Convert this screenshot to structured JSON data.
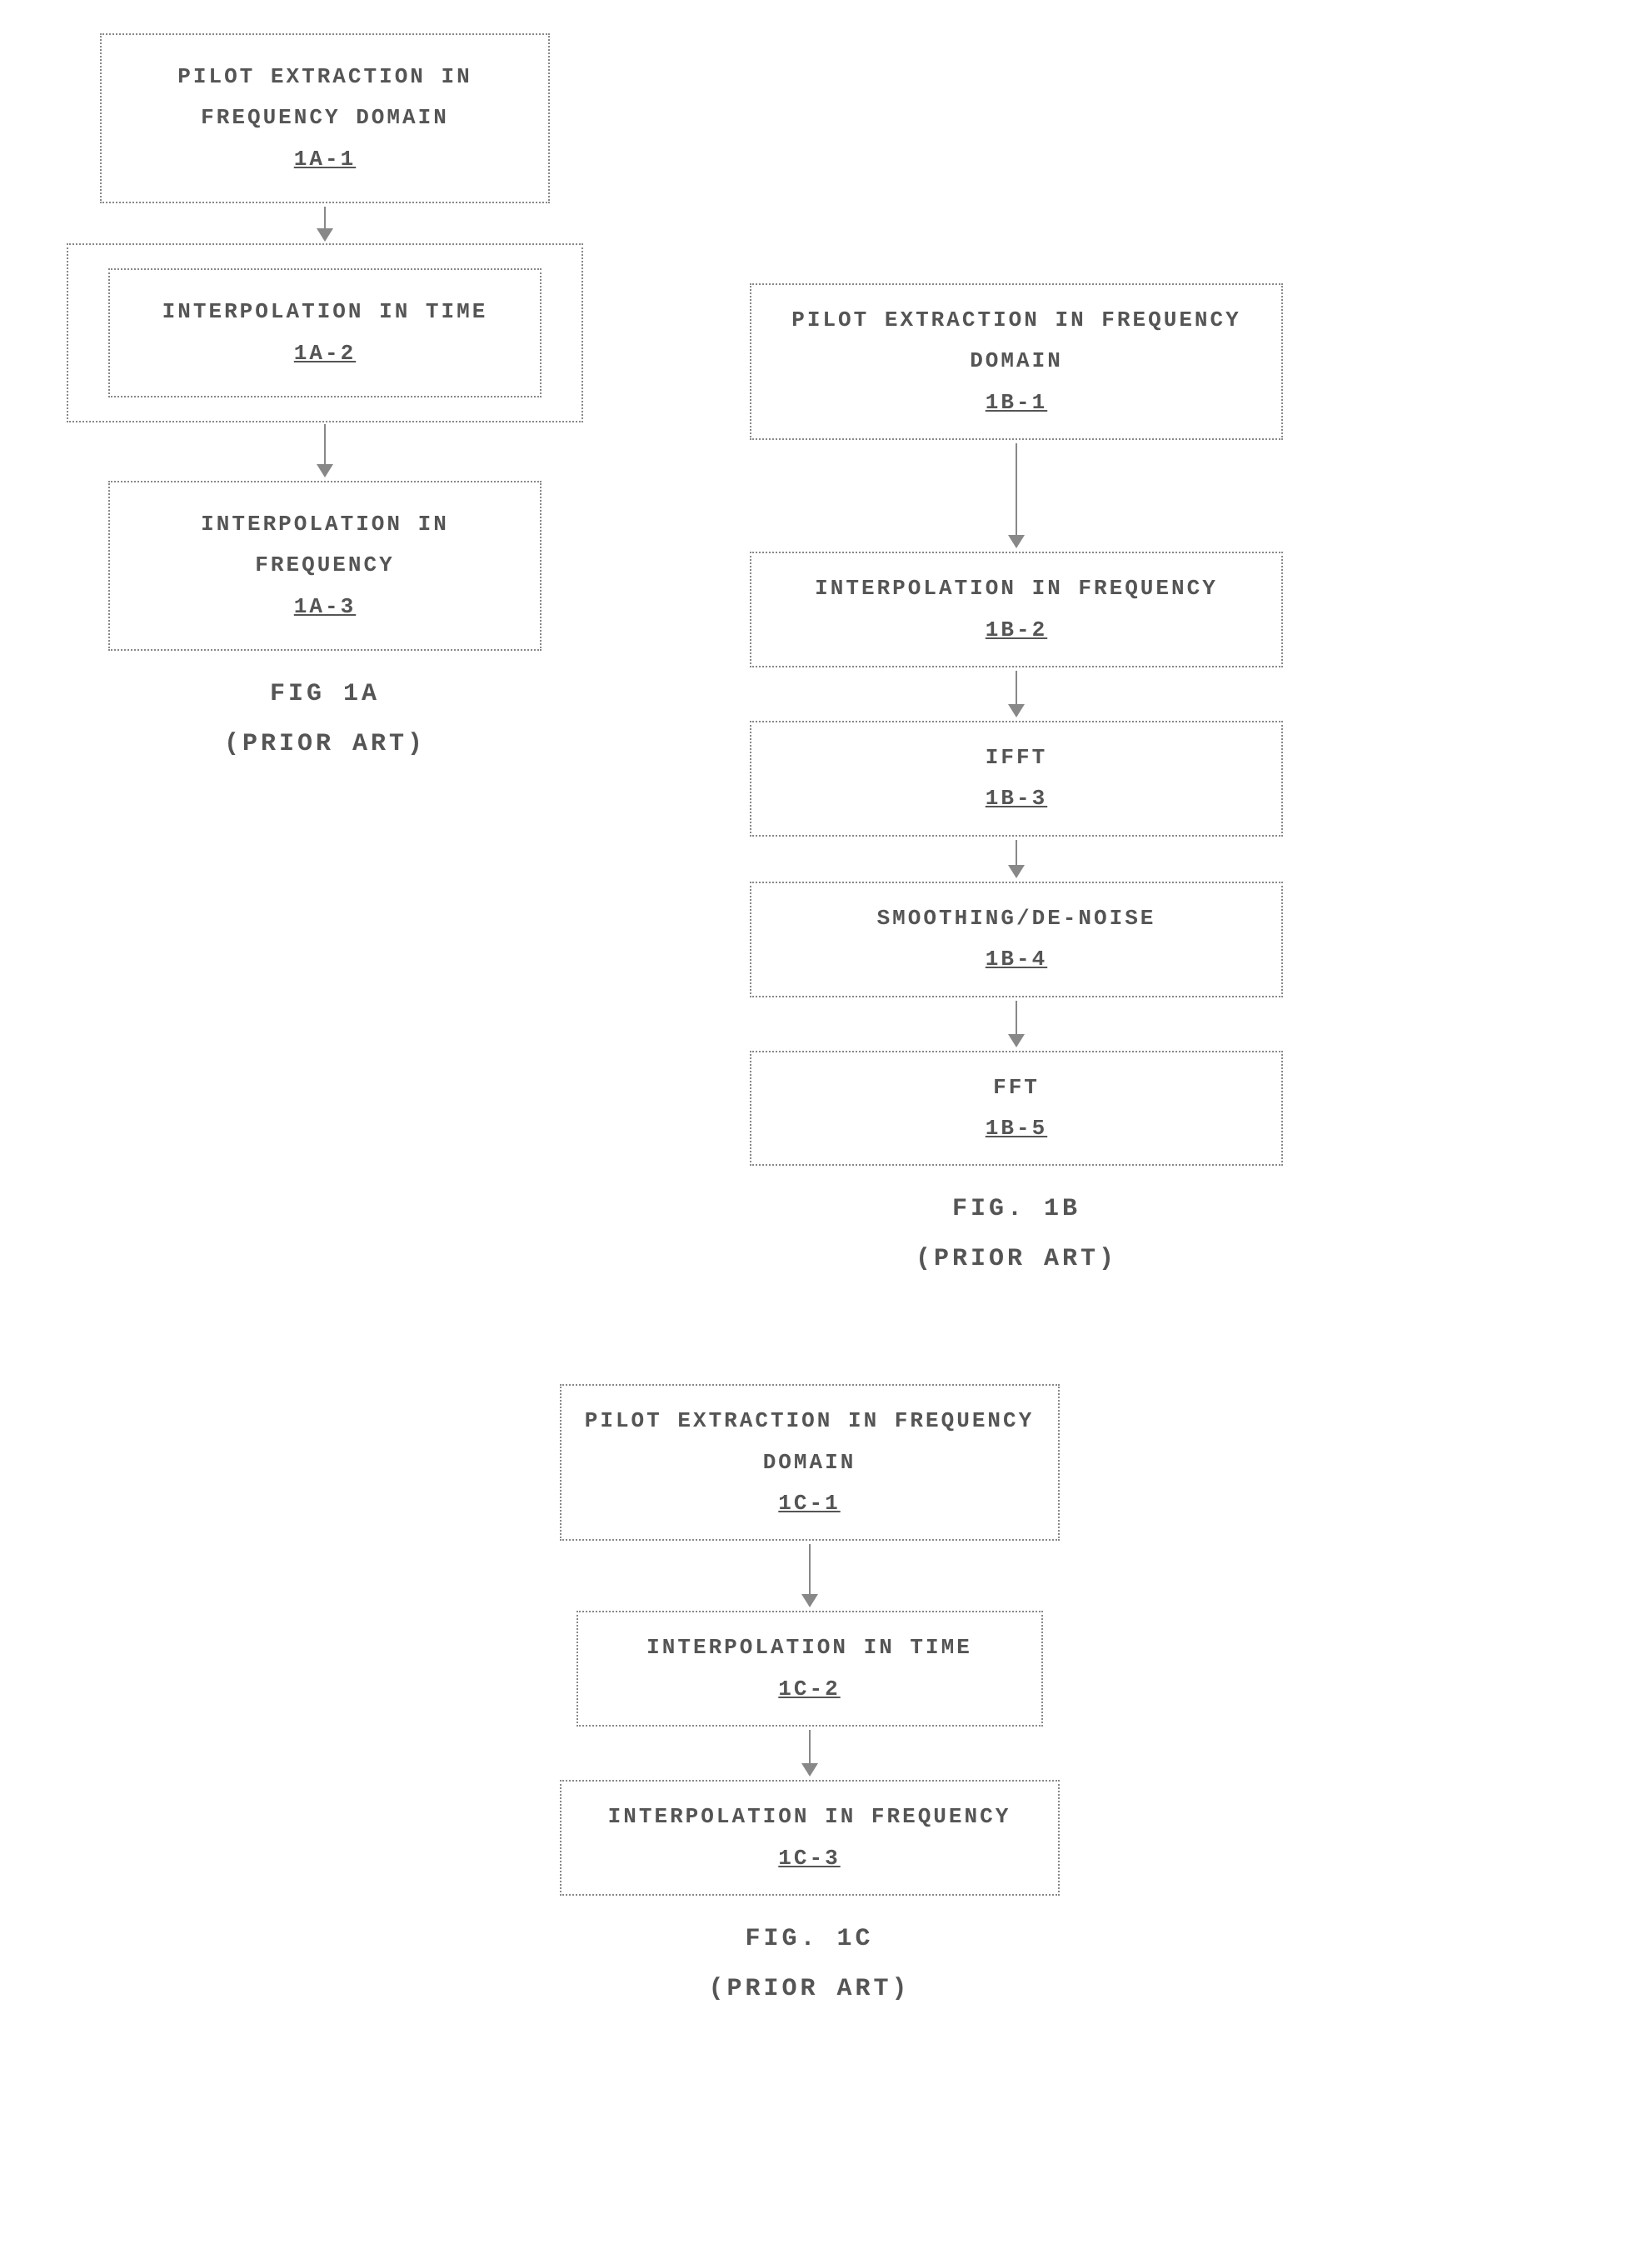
{
  "figA": {
    "b1_l1": "PILOT EXTRACTION IN",
    "b1_l2": "FREQUENCY DOMAIN",
    "b1_ref": "1A-1",
    "b2_l1": "INTERPOLATION IN TIME",
    "b2_ref": "1A-2",
    "b3_l1": "INTERPOLATION IN",
    "b3_l2": "FREQUENCY",
    "b3_ref": "1A-3",
    "caption_l1": "FIG 1A",
    "caption_l2": "(PRIOR ART)"
  },
  "figB": {
    "b1_l1": "PILOT EXTRACTION IN FREQUENCY",
    "b1_l2": "DOMAIN",
    "b1_ref": "1B-1",
    "b2_l1": "INTERPOLATION IN FREQUENCY",
    "b2_ref": "1B-2",
    "b3_l1": "IFFT",
    "b3_ref": "1B-3",
    "b4_l1": "SMOOTHING/DE-NOISE",
    "b4_ref": "1B-4",
    "b5_l1": "FFT",
    "b5_ref": "1B-5",
    "caption_l1": "FIG. 1B",
    "caption_l2": "(PRIOR ART)"
  },
  "figC": {
    "b1_l1": "PILOT EXTRACTION IN FREQUENCY",
    "b1_l2": "DOMAIN",
    "b1_ref": "1C-1",
    "b2_l1": "INTERPOLATION IN TIME",
    "b2_ref": "1C-2",
    "b3_l1": "INTERPOLATION IN FREQUENCY",
    "b3_ref": "1C-3",
    "caption_l1": "FIG. 1C",
    "caption_l2": "(PRIOR ART)"
  }
}
